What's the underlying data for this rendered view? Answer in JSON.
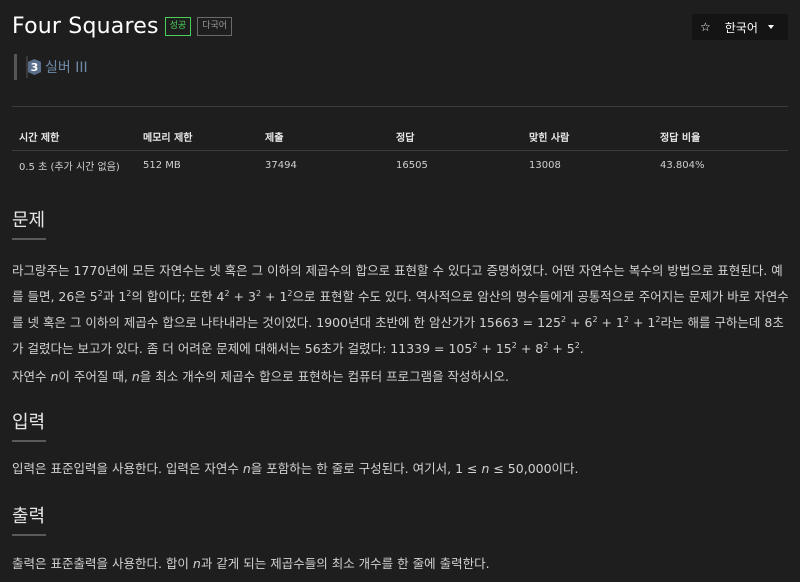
{
  "problem": {
    "title": "Four Squares",
    "badges": {
      "success": "성공",
      "multi": "다국어"
    },
    "tier": {
      "number": "3",
      "label": "실버 III"
    }
  },
  "lang_selector": {
    "star": "☆",
    "label": "한국어"
  },
  "stats": {
    "headers": [
      "시간 제한",
      "메모리 제한",
      "제출",
      "정답",
      "맞힌 사람",
      "정답 비율"
    ],
    "values": [
      "0.5 초 (추가 시간 없음)",
      "512 MB",
      "37494",
      "16505",
      "13008",
      "43.804%"
    ]
  },
  "sections": {
    "problem": "문제",
    "input": "입력",
    "output": "출력"
  },
  "text": {
    "p1a": "라그랑주는 1770년에 모든 자연수는 넷 혹은 그 이하의 제곱수의 합으로 표현할 수 있다고 증명하였다. 어떤 자연수는 복수의 방법으로 표현된다. 예를 들면, 26은 5",
    "p1b": "과 1",
    "p1c": "의 합이다; 또한 4",
    "p1d": " + 3",
    "p1e": " + 1",
    "p1f": "으로 표현할 수도 있다. 역사적으로 암산의 명수들에게 공통적으로 주어지는 문제가 바로 자연수를 넷 혹은 그 이하의 제곱수 합으로 나타내라는 것이었다. 1900년대 초반에 한 암산가가 15663 = 125",
    "p1g": " + 6",
    "p1h": " + 1",
    "p1i": " + 1",
    "p1j": "라는 해를 구하는데 8초가 걸렸다는 보고가 있다. 좀 더 어려운 문제에 대해서는 56초가 걸렸다: 11339 = 105",
    "p1k": " + 15",
    "p1l": " + 8",
    "p1m": " + 5",
    "p1n": ".",
    "sq": "2",
    "p2a": "자연수 ",
    "p2b": "이 주어질 때, ",
    "p2c": "을 최소 개수의 제곱수 합으로 표현하는 컴퓨터 프로그램을 작성하시오.",
    "n": "n",
    "in_a": "입력은 표준입력을 사용한다. 입력은 자연수 ",
    "in_b": "을 포함하는 한 줄로 구성된다. 여기서, 1 ≤ ",
    "in_c": " ≤ 50,000이다.",
    "out_a": "출력은 표준출력을 사용한다. 합이 ",
    "out_b": "과 같게 되는 제곱수들의 최소 개수를 한 줄에 출력한다."
  }
}
